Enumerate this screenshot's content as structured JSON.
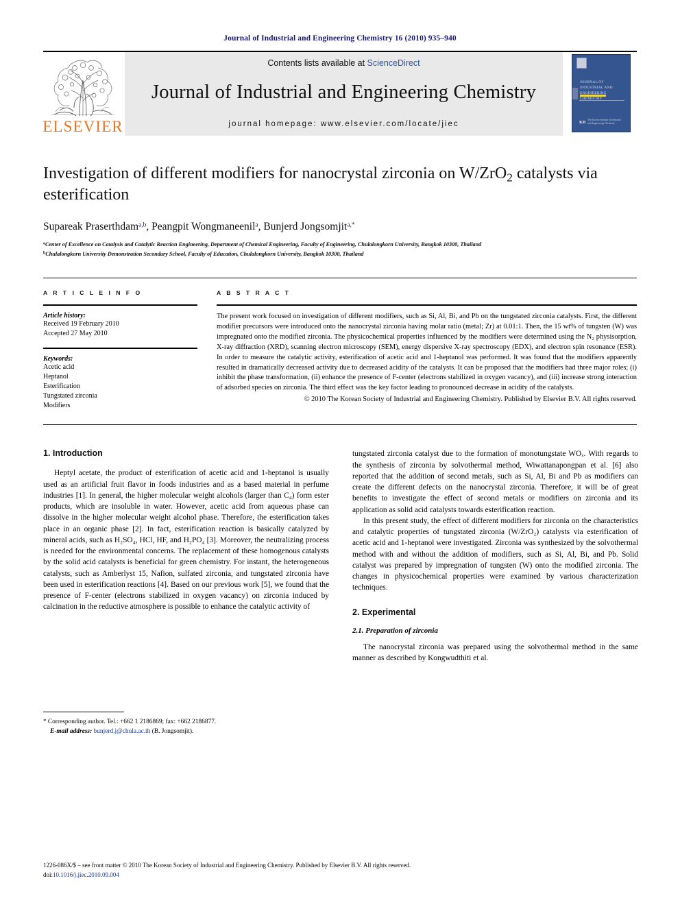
{
  "running_head": "Journal of Industrial and Engineering Chemistry 16 (2010) 935–940",
  "masthead": {
    "contents_prefix": "Contents lists available at ",
    "sciencedirect": "ScienceDirect",
    "journal_title": "Journal of Industrial and Engineering Chemistry",
    "homepage": "journal homepage: www.elsevier.com/locate/jiec",
    "publisher_name": "ELSEVIER",
    "cover_title_lines": "JOURNAL OF INDUSTRIAL AND ENGINEERING CHEMISTRY",
    "cover_society_abbr": "KB",
    "cover_society_text": "The Korean Institute of Industrial and Engineering Chemistry",
    "accent_blue": "#2b57a4",
    "elsevier_orange": "#E87722",
    "panel_grey": "#e9e9e9"
  },
  "article": {
    "title": "Investigation of different modifiers for nanocrystal zirconia on W/ZrO₂ catalysts via esterification",
    "title_part1": "Investigation of different modifiers for nanocrystal zirconia on W/ZrO",
    "title_sub": "2",
    "title_part2": "catalysts via esterification",
    "authors": "Supareak Praserthdam, Peangpit Wongmaneenil, Bunjerd Jongsomjit",
    "author_list": [
      {
        "name": "Supareak Praserthdam",
        "marks": "a,b"
      },
      {
        "name": "Peangpit Wongmaneenil",
        "marks": "a"
      },
      {
        "name": "Bunjerd Jongsomjit",
        "marks": "a,*"
      }
    ],
    "affiliations": [
      {
        "mark": "a",
        "text": "Center of Excellence on Catalysis and Catalytic Reaction Engineering, Department of Chemical Engineering, Faculty of Engineering, Chulalongkorn University, Bangkok 10300, Thailand"
      },
      {
        "mark": "b",
        "text": "Chulalongkorn University Demonstration Secondary School, Faculty of Education, Chulalongkorn University, Bangkok 10300, Thailand"
      }
    ]
  },
  "article_info": {
    "heading": "A R T I C L E   I N F O",
    "history_label": "Article history:",
    "received": "Received 19 February 2010",
    "accepted": "Accepted 27 May 2010",
    "keywords_label": "Keywords:",
    "keywords": [
      "Acetic acid",
      "Heptanol",
      "Esterification",
      "Tungstated zirconia",
      "Modifiers"
    ]
  },
  "abstract": {
    "heading": "A B S T R A C T",
    "text": "The present work focused on investigation of different modifiers, such as Si, Al, Bi, and Pb on the tungstated zirconia catalysts. First, the different modifier precursors were introduced onto the nanocrystal zirconia having molar ratio (metal; Zr) at 0.01:1. Then, the 15 wt% of tungsten (W) was impregnated onto the modified zirconia. The physicochemical properties influenced by the modifiers were determined using the N₂ physisorption, X-ray diffraction (XRD), scanning electron microscopy (SEM), energy dispersive X-ray spectroscopy (EDX), and electron spin resonance (ESR). In order to measure the catalytic activity, esterification of acetic acid and 1-heptanol was performed. It was found that the modifiers apparently resulted in dramatically decreased activity due to decreased acidity of the catalysts. It can be proposed that the modifiers had three major roles; (i) inhibit the phase transformation, (ii) enhance the presence of F-center (electrons stabilized in oxygen vacancy), and (iii) increase strong interaction of adsorbed species on zirconia. The third effect was the key factor leading to pronounced decrease in acidity of the catalysts.",
    "copyright": "© 2010 The Korean Society of Industrial and Engineering Chemistry. Published by Elsevier B.V. All rights reserved."
  },
  "body": {
    "intro_heading": "1. Introduction",
    "intro_p1": "Heptyl acetate, the product of esterification of acetic acid and 1-heptanol is usually used as an artificial fruit flavor in foods industries and as a based material in perfume industries [1]. In general, the higher molecular weight alcohols (larger than C₄) form ester products, which are insoluble in water. However, acetic acid from aqueous phase can dissolve in the higher molecular weight alcohol phase. Therefore, the esterification takes place in an organic phase [2]. In fact, esterification reaction is basically catalyzed by mineral acids, such as H₂SO₄, HCl, HF, and H₂PO₄ [3]. Moreover, the neutralizing process is needed for the environmental concerns. The replacement of these homogenous catalysts by the solid acid catalysts is beneficial for green chemistry. For instant, the heterogeneous catalysts, such as Amberlyst 15, Nafion, sulfated zirconia, and tungstated zirconia have been used in esterification reactions [4]. Based on our previous work [5], we found that the presence of F-center (electrons stabilized in oxygen vacancy) on zirconia induced by calcination in the reductive atmosphere is possible to enhance the catalytic activity of",
    "right_p1": "tungstated zirconia catalyst due to the formation of monotungstate WOₓ. With regards to the synthesis of zirconia by solvothermal method, Wiwattanapongpan et al. [6] also reported that the addition of second metals, such as Si, Al, Bi and Pb as modifiers can create the different defects on the nanocrystal zirconia. Therefore, it will be of great benefits to investigate the effect of second metals or modifiers on zirconia and its application as solid acid catalysts towards esterification reaction.",
    "right_p2": "In this present study, the effect of different modifiers for zirconia on the characteristics and catalytic properties of tungstated zirconia (W/ZrO₂) catalysts via esterification of acetic acid and 1-heptanol were investigated. Zirconia was synthesized by the solvothermal method with and without the addition of modifiers, such as Si, Al, Bi, and Pb. Solid catalyst was prepared by impregnation of tungsten (W) onto the modified zirconia. The changes in physicochemical properties were examined by various characterization techniques.",
    "exp_heading": "2. Experimental",
    "exp_sub_heading": "2.1. Preparation of zirconia",
    "exp_p1": "The nanocrystal zirconia was prepared using the solvothermal method in the same manner as described by Kongwudthiti et al."
  },
  "footnote": {
    "star": "*",
    "corresponding": "Corresponding author. Tel.: +662 1 2186869; fax: +662 2186877.",
    "email_label": "E-mail address:",
    "email": "bunjerd.j@chula.ac.th",
    "email_owner": "(B. Jongsomjit)."
  },
  "page_footer": {
    "issn_line": "1226-086X/$ – see front matter © 2010 The Korean Society of Industrial and Engineering Chemistry. Published by Elsevier B.V. All rights reserved.",
    "doi_label": "doi:",
    "doi": "10.1016/j.jiec.2010.09.004"
  }
}
